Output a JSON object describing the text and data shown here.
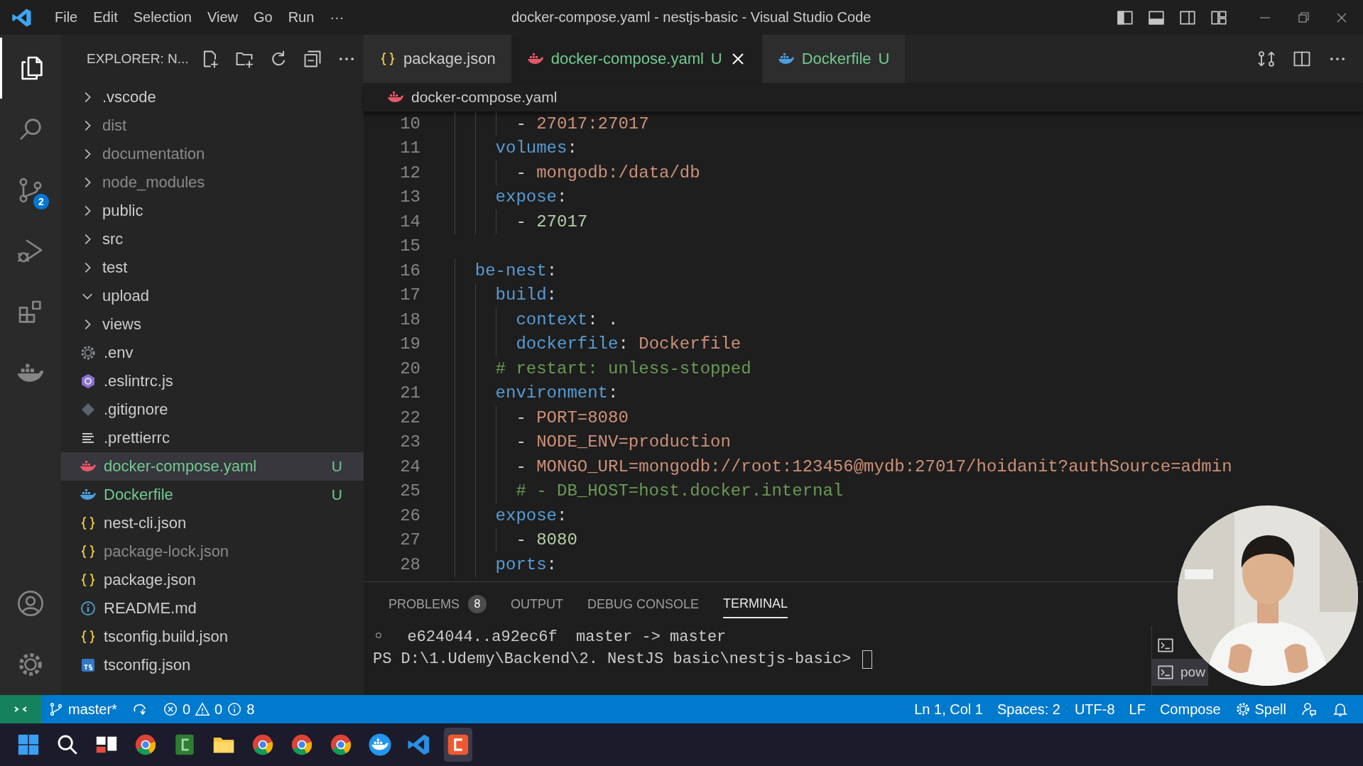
{
  "window": {
    "title": "docker-compose.yaml - nestjs-basic - Visual Studio Code"
  },
  "menu": [
    "File",
    "Edit",
    "Selection",
    "View",
    "Go",
    "Run",
    "···"
  ],
  "activity_bar": {
    "items": [
      {
        "kind": "files",
        "selected": true
      },
      {
        "kind": "search",
        "selected": false
      },
      {
        "kind": "source-control",
        "selected": false,
        "badge": "2"
      },
      {
        "kind": "run",
        "selected": false
      },
      {
        "kind": "extensions",
        "selected": false
      },
      {
        "kind": "docker",
        "selected": false
      }
    ],
    "bottom": [
      {
        "kind": "account"
      },
      {
        "kind": "settings"
      }
    ]
  },
  "explorer": {
    "title": "EXPLORER: N...",
    "items": [
      {
        "label": ".vscode",
        "kind": "folder",
        "expanded": false,
        "dimmed": false,
        "selected": false
      },
      {
        "label": "dist",
        "kind": "folder",
        "expanded": false,
        "dimmed": true,
        "selected": false
      },
      {
        "label": "documentation",
        "kind": "folder",
        "expanded": false,
        "dimmed": true,
        "selected": false
      },
      {
        "label": "node_modules",
        "kind": "folder",
        "expanded": false,
        "dimmed": true,
        "selected": false
      },
      {
        "label": "public",
        "kind": "folder",
        "expanded": false,
        "dimmed": false,
        "selected": false
      },
      {
        "label": "src",
        "kind": "folder",
        "expanded": false,
        "dimmed": false,
        "selected": false
      },
      {
        "label": "test",
        "kind": "folder",
        "expanded": false,
        "dimmed": false,
        "selected": false
      },
      {
        "label": "upload",
        "kind": "folder",
        "expanded": true,
        "dimmed": false,
        "selected": false
      },
      {
        "label": "views",
        "kind": "folder",
        "expanded": false,
        "dimmed": false,
        "selected": false
      },
      {
        "label": ".env",
        "kind": "config",
        "dimmed": false,
        "selected": false
      },
      {
        "label": ".eslintrc.js",
        "kind": "eslint",
        "dimmed": false,
        "selected": false
      },
      {
        "label": ".gitignore",
        "kind": "git",
        "dimmed": false,
        "selected": false
      },
      {
        "label": ".prettierrc",
        "kind": "text",
        "dimmed": false,
        "selected": false
      },
      {
        "label": "docker-compose.yaml",
        "kind": "compose",
        "dimmed": false,
        "selected": true,
        "status": "U"
      },
      {
        "label": "Dockerfile",
        "kind": "docker",
        "dimmed": false,
        "selected": false,
        "status": "U"
      },
      {
        "label": "nest-cli.json",
        "kind": "json",
        "dimmed": false,
        "selected": false
      },
      {
        "label": "package-lock.json",
        "kind": "json",
        "dimmed": true,
        "selected": false
      },
      {
        "label": "package.json",
        "kind": "json",
        "dimmed": false,
        "selected": false
      },
      {
        "label": "README.md",
        "kind": "info",
        "dimmed": false,
        "selected": false
      },
      {
        "label": "tsconfig.build.json",
        "kind": "json",
        "dimmed": false,
        "selected": false
      },
      {
        "label": "tsconfig.json",
        "kind": "ts",
        "dimmed": false,
        "selected": false
      }
    ]
  },
  "tabs": [
    {
      "label": "package.json",
      "kind": "json",
      "selected": false
    },
    {
      "label": "docker-compose.yaml",
      "kind": "compose",
      "status": "U",
      "selected": true
    },
    {
      "label": "Dockerfile",
      "kind": "docker",
      "status": "U",
      "selected": false
    }
  ],
  "breadcrumb": {
    "kind": "compose",
    "label": "docker-compose.yaml"
  },
  "editor": {
    "lines": [
      {
        "number": "10",
        "tokens": [
          {
            "kind": "punct",
            "text": "      - "
          },
          {
            "kind": "string",
            "text": "27017:27017"
          }
        ]
      },
      {
        "number": "11",
        "tokens": [
          {
            "kind": "key",
            "text": "    volumes"
          },
          {
            "kind": "punct",
            "text": ":"
          }
        ]
      },
      {
        "number": "12",
        "tokens": [
          {
            "kind": "punct",
            "text": "      - "
          },
          {
            "kind": "string",
            "text": "mongodb:/data/db"
          }
        ]
      },
      {
        "number": "13",
        "tokens": [
          {
            "kind": "key",
            "text": "    expose"
          },
          {
            "kind": "punct",
            "text": ":"
          }
        ]
      },
      {
        "number": "14",
        "tokens": [
          {
            "kind": "punct",
            "text": "      - "
          },
          {
            "kind": "number",
            "text": "27017"
          }
        ]
      },
      {
        "number": "15"
      },
      {
        "number": "16",
        "tokens": [
          {
            "kind": "key",
            "text": "  be-nest"
          },
          {
            "kind": "punct",
            "text": ":"
          }
        ]
      },
      {
        "number": "17",
        "tokens": [
          {
            "kind": "key",
            "text": "    build"
          },
          {
            "kind": "punct",
            "text": ":"
          }
        ]
      },
      {
        "number": "18",
        "tokens": [
          {
            "kind": "key",
            "text": "      context"
          },
          {
            "kind": "punct",
            "text": ": ."
          }
        ]
      },
      {
        "number": "19",
        "tokens": [
          {
            "kind": "key",
            "text": "      dockerfile"
          },
          {
            "kind": "punct",
            "text": ": "
          },
          {
            "kind": "string",
            "text": "Dockerfile"
          }
        ]
      },
      {
        "number": "20",
        "tokens": [
          {
            "kind": "comment",
            "text": "    # restart: unless-stopped"
          }
        ]
      },
      {
        "number": "21",
        "tokens": [
          {
            "kind": "key",
            "text": "    environment"
          },
          {
            "kind": "punct",
            "text": ":"
          }
        ]
      },
      {
        "number": "22",
        "tokens": [
          {
            "kind": "punct",
            "text": "      - "
          },
          {
            "kind": "string",
            "text": "PORT=8080"
          }
        ]
      },
      {
        "number": "23",
        "tokens": [
          {
            "kind": "punct",
            "text": "      - "
          },
          {
            "kind": "string",
            "text": "NODE_ENV=production"
          }
        ]
      },
      {
        "number": "24",
        "tokens": [
          {
            "kind": "punct",
            "text": "      - "
          },
          {
            "kind": "string",
            "text": "MONGO_URL=mongodb://root:123456@mydb:27017/hoidanit?authSource=admin"
          }
        ]
      },
      {
        "number": "25",
        "tokens": [
          {
            "kind": "comment",
            "text": "      # - DB_HOST=host.docker.internal"
          }
        ]
      },
      {
        "number": "26",
        "tokens": [
          {
            "kind": "key",
            "text": "    expose"
          },
          {
            "kind": "punct",
            "text": ":"
          }
        ]
      },
      {
        "number": "27",
        "tokens": [
          {
            "kind": "punct",
            "text": "      - "
          },
          {
            "kind": "number",
            "text": "8080"
          }
        ]
      },
      {
        "number": "28",
        "tokens": [
          {
            "kind": "key",
            "text": "    ports"
          },
          {
            "kind": "punct",
            "text": ":"
          }
        ]
      }
    ]
  },
  "panel": {
    "tabs": [
      {
        "label": "PROBLEMS",
        "badge": "8",
        "selected": false
      },
      {
        "label": "OUTPUT",
        "selected": false
      },
      {
        "label": "DEBUG CONSOLE",
        "selected": false
      },
      {
        "label": "TERMINAL",
        "selected": true
      }
    ],
    "terminal": [
      {
        "kind": "output",
        "text": "e624044..a92ec6f  master -> master"
      },
      {
        "kind": "prompt",
        "text": "PS D:\\1.Udemy\\Backend\\2. NestJS basic\\nestjs-basic> "
      }
    ],
    "terminal_list": [
      {
        "selected": false
      },
      {
        "label": "pow",
        "selected": true
      }
    ]
  },
  "status_bar": {
    "branch": "master*",
    "errors": "0",
    "warnings": "0",
    "infos": "8",
    "right": [
      "Ln 1, Col 1",
      "Spaces: 2",
      "UTF-8",
      "LF",
      "Compose"
    ],
    "spell": "Spell"
  },
  "taskbar": [
    {
      "kind": "start",
      "selected": false
    },
    {
      "kind": "search",
      "selected": false
    },
    {
      "kind": "taskview",
      "selected": false
    },
    {
      "kind": "browser",
      "selected": false
    },
    {
      "kind": "app-green",
      "selected": false
    },
    {
      "kind": "folder",
      "selected": false
    },
    {
      "kind": "browser",
      "selected": false
    },
    {
      "kind": "browser",
      "selected": false
    },
    {
      "kind": "browser",
      "selected": false
    },
    {
      "kind": "docker",
      "selected": false
    },
    {
      "kind": "code",
      "selected": false
    },
    {
      "kind": "app-red",
      "selected": true
    }
  ]
}
